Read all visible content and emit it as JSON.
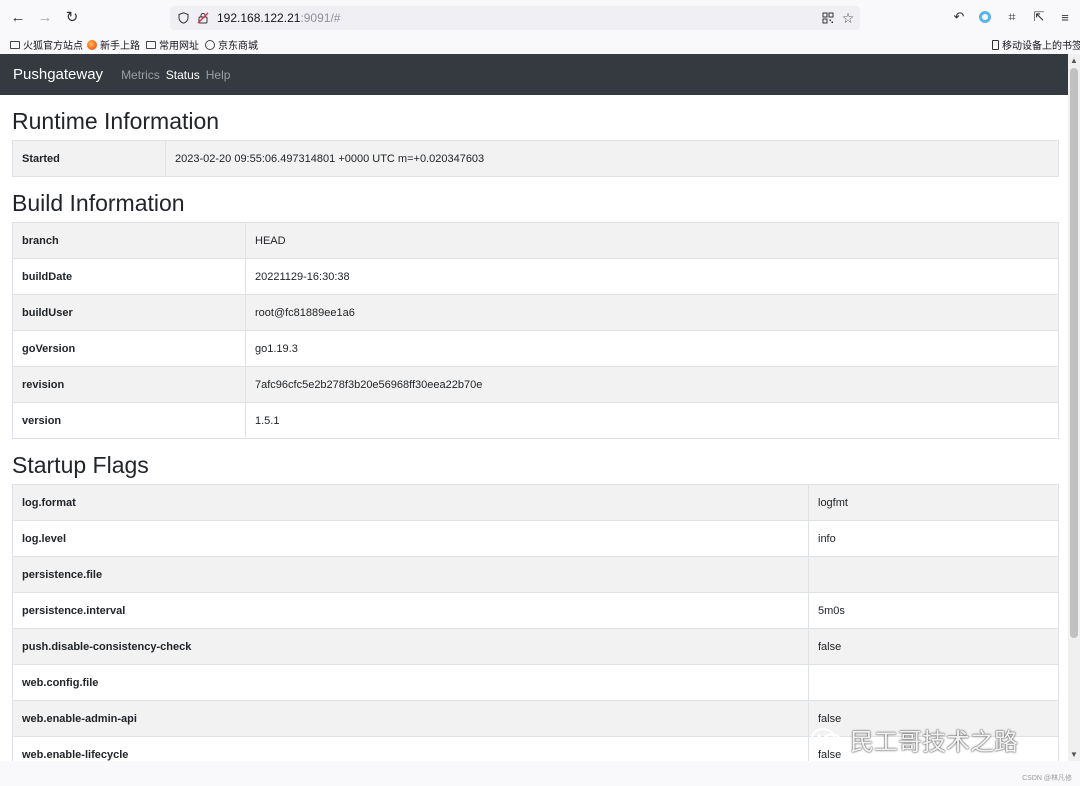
{
  "browser": {
    "url_host": "192.168.122.21",
    "url_rest": ":9091/#",
    "bookmarks": [
      "火狐官方站点",
      "新手上路",
      "常用网址",
      "京东商城"
    ],
    "mobile_bookmarks": "移动设备上的书签"
  },
  "navbar": {
    "brand": "Pushgateway",
    "links": [
      "Metrics",
      "Status",
      "Help"
    ],
    "active": "Status"
  },
  "runtime": {
    "title": "Runtime Information",
    "rows": [
      {
        "key": "Started",
        "value": "2023-02-20 09:55:06.497314801 +0000 UTC m=+0.020347603"
      }
    ]
  },
  "build": {
    "title": "Build Information",
    "rows": [
      {
        "key": "branch",
        "value": "HEAD"
      },
      {
        "key": "buildDate",
        "value": "20221129-16:30:38"
      },
      {
        "key": "buildUser",
        "value": "root@fc81889ee1a6"
      },
      {
        "key": "goVersion",
        "value": "go1.19.3"
      },
      {
        "key": "revision",
        "value": "7afc96cfc5e2b278f3b20e56968ff30eea22b70e"
      },
      {
        "key": "version",
        "value": "1.5.1"
      }
    ]
  },
  "flags": {
    "title": "Startup Flags",
    "rows": [
      {
        "key": "log.format",
        "value": "logfmt"
      },
      {
        "key": "log.level",
        "value": "info"
      },
      {
        "key": "persistence.file",
        "value": ""
      },
      {
        "key": "persistence.interval",
        "value": "5m0s"
      },
      {
        "key": "push.disable-consistency-check",
        "value": "false"
      },
      {
        "key": "web.config.file",
        "value": ""
      },
      {
        "key": "web.enable-admin-api",
        "value": "false"
      },
      {
        "key": "web.enable-lifecycle",
        "value": "false"
      }
    ]
  },
  "watermark": "民工哥技术之路",
  "footer": "CSDN @林凡修",
  "icons": {
    "back": "back-arrow-icon",
    "forward": "forward-arrow-icon",
    "reload": "reload-icon",
    "shield": "shield-icon",
    "insecure": "insecure-lock-icon",
    "qr": "qr-code-icon",
    "star": "bookmark-star-icon",
    "undo": "undo-icon",
    "extension": "extension-icon",
    "crop": "crop-icon",
    "share": "share-icon",
    "menu": "hamburger-menu-icon"
  }
}
